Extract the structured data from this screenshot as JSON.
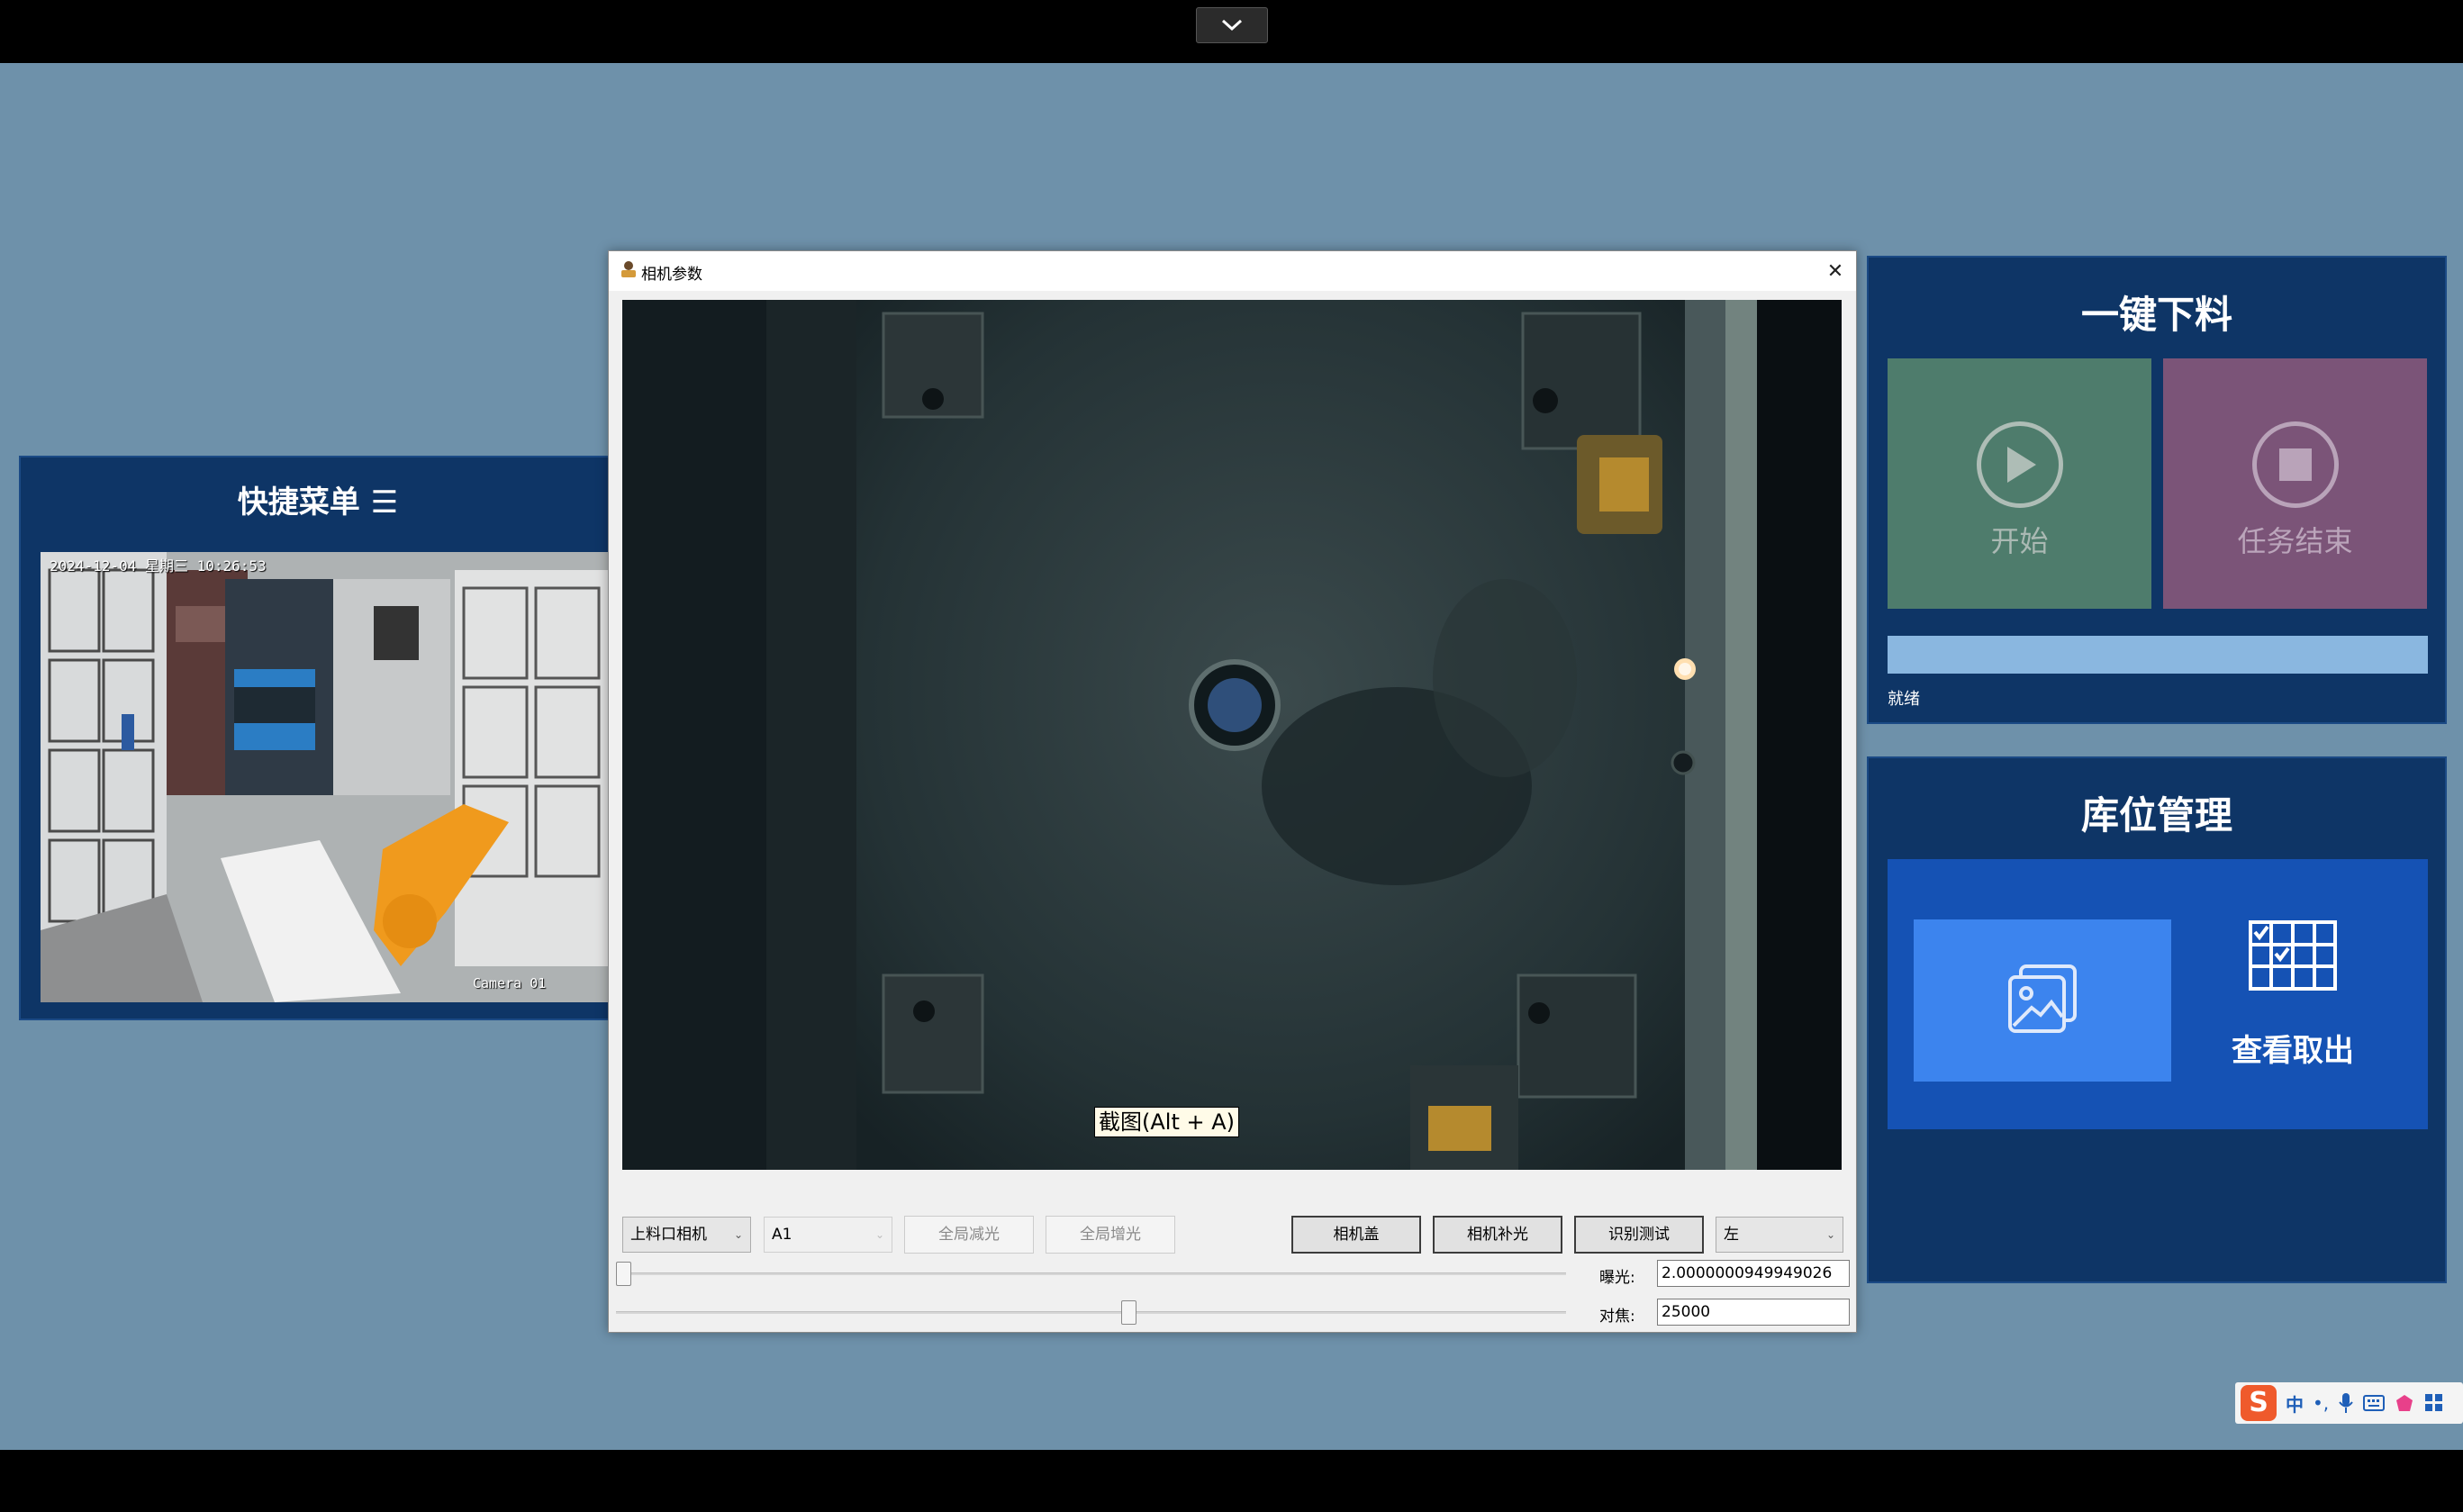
{
  "topbar": {
    "collapse_icon": "chevron-down-icon"
  },
  "quick_menu": {
    "title": "快捷菜单",
    "menu_glyph": "☰",
    "camera_timestamp": "2024-12-04 星期三 10:26:53",
    "camera_name": "Camera 01"
  },
  "dialog": {
    "title": "相机参数",
    "close_glyph": "✕",
    "screenshot_hint": "截图(Alt + A)",
    "camera_select": "上料口相机",
    "slot_select": "A1",
    "btn_global_dim": "全局减光",
    "btn_global_boost": "全局增光",
    "btn_camera_cover": "相机盖",
    "btn_camera_fill_light": "相机补光",
    "btn_recognition_test": "识别测试",
    "side_select": "左",
    "exposure_label": "曝光:",
    "exposure_value": "2.0000000949949026",
    "focus_label": "对焦:",
    "focus_value": "25000",
    "exposure_slider_level": 0.0,
    "focus_slider_level": 0.54
  },
  "unload_panel": {
    "title": "一键下料",
    "start_label": "开始",
    "stop_label": "任务结束",
    "status": "就绪",
    "progress": 0
  },
  "storage_panel": {
    "title": "库位管理",
    "view_label": "查看取出"
  },
  "ime": {
    "logo": "S",
    "lang": "中",
    "punct": "•,"
  },
  "colors": {
    "desktop_bg": "#6e91aa",
    "panel_bg": "#0e3566",
    "start_tile": "#4e7c6c",
    "stop_tile": "#7b5478",
    "progress_bg": "#8ab7e0",
    "storage_inner": "#1552b4",
    "gallery_tile": "#3c84ee"
  }
}
